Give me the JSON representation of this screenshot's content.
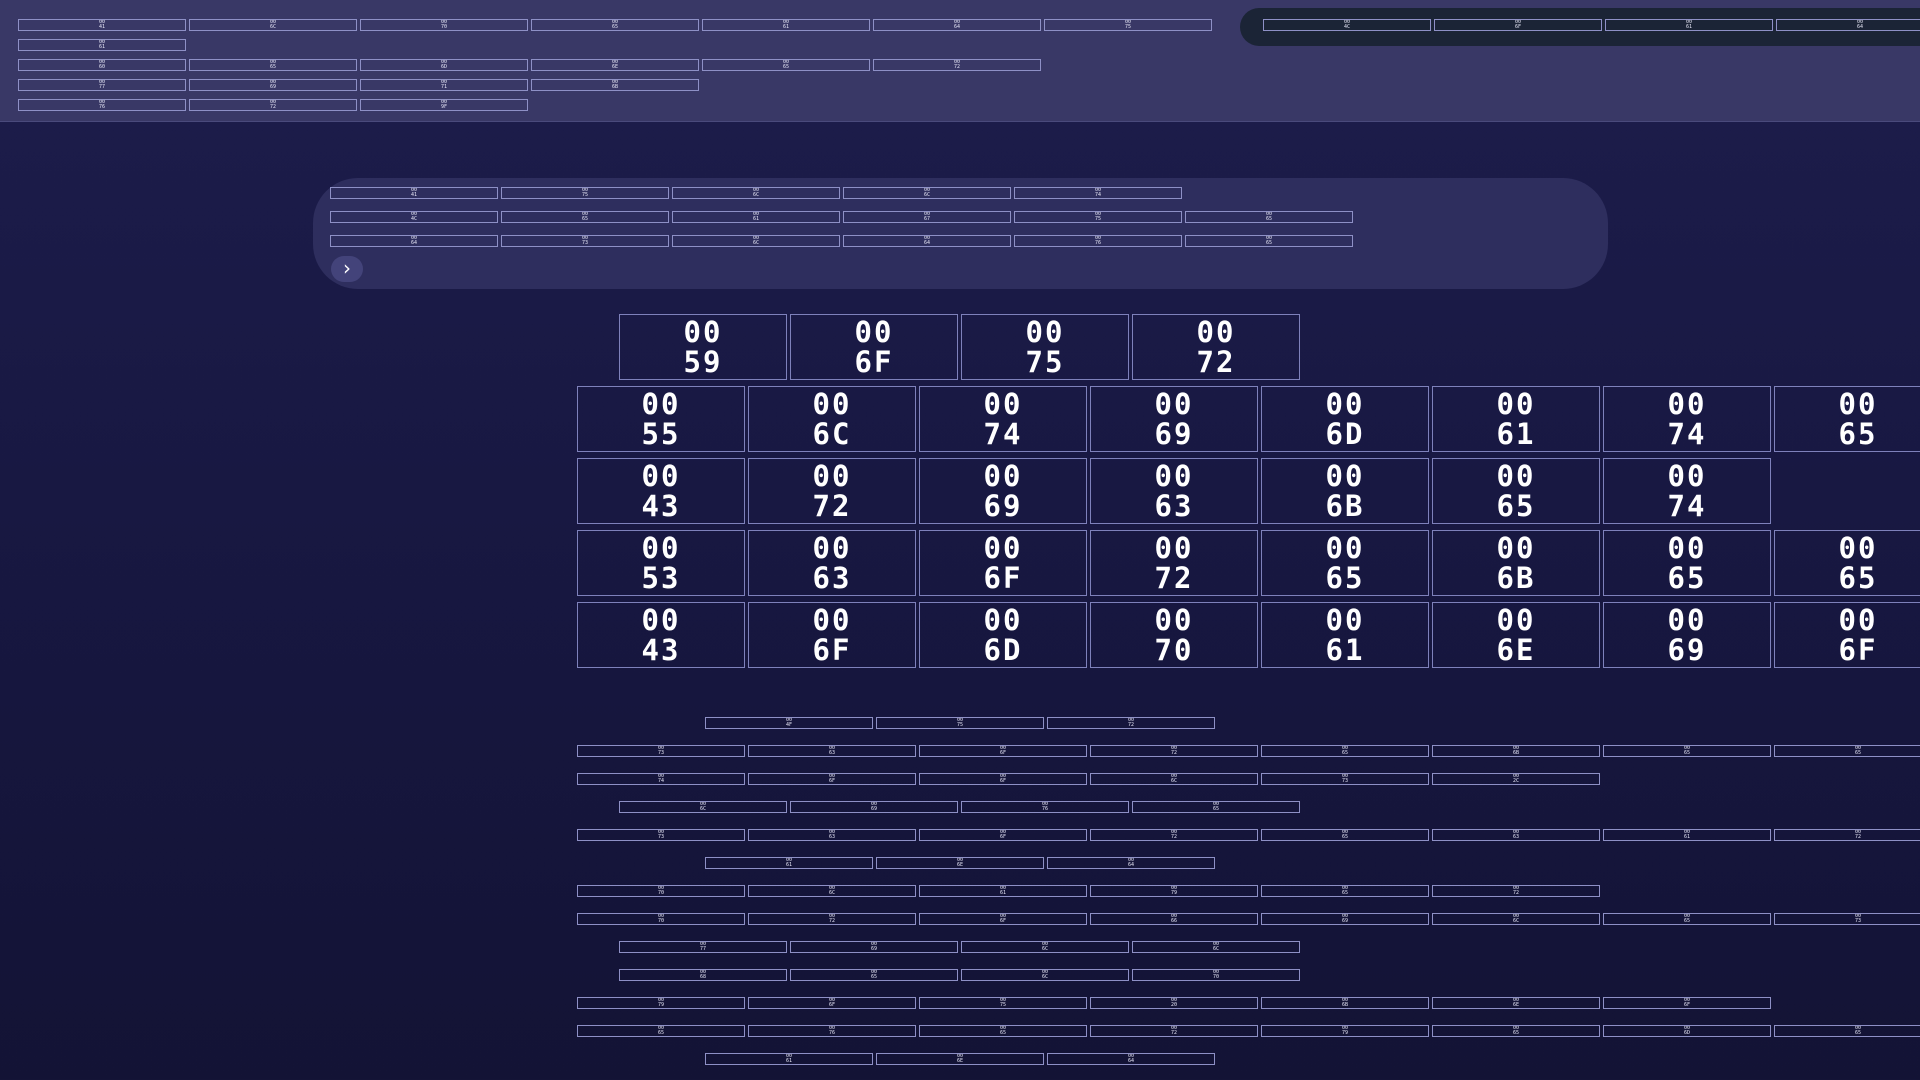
{
  "nav_icon": "chevron-right-icon",
  "nav_glyph": "›",
  "hex_prefix": "00",
  "top_block": [
    [
      "41",
      "6C",
      "70",
      "65",
      "61",
      "64",
      "75"
    ],
    [
      "61"
    ],
    [
      "60",
      "65",
      "6D",
      "6E",
      "65",
      "72"
    ],
    [
      "77",
      "69",
      "71",
      "6B"
    ],
    [
      "76",
      "72",
      "9F"
    ]
  ],
  "top_right_block": [
    [
      "4C",
      "6F",
      "61",
      "64"
    ]
  ],
  "panel_block": [
    [
      "41",
      "75",
      "6C",
      "6C",
      "74"
    ],
    [
      "4C",
      "65",
      "61",
      "67",
      "75",
      "65"
    ],
    [
      "64",
      "73",
      "6C",
      "64",
      "76",
      "65"
    ]
  ],
  "large_block": [
    [
      "59",
      "6F",
      "75",
      "72"
    ],
    [
      "55",
      "6C",
      "74",
      "69",
      "6D",
      "61",
      "74",
      "65"
    ],
    [
      "43",
      "72",
      "69",
      "63",
      "6B",
      "65",
      "74"
    ],
    [
      "53",
      "63",
      "6F",
      "72",
      "65",
      "6B",
      "65",
      "65"
    ],
    [
      "43",
      "6F",
      "6D",
      "70",
      "61",
      "6E",
      "69",
      "6F"
    ]
  ],
  "bottom_block": [
    [
      "4F",
      "75",
      "72"
    ],
    [
      "73",
      "63",
      "6F",
      "72",
      "65",
      "6B",
      "65",
      "65"
    ],
    [
      "74",
      "6F",
      "6F",
      "6C",
      "73",
      "2C"
    ],
    [
      "6C",
      "69",
      "76",
      "65"
    ],
    [
      "73",
      "63",
      "6F",
      "72",
      "65",
      "63",
      "61",
      "72"
    ],
    [
      "61",
      "6E",
      "64"
    ],
    [
      "70",
      "6C",
      "61",
      "79",
      "65",
      "72"
    ],
    [
      "70",
      "72",
      "6F",
      "66",
      "69",
      "6C",
      "65",
      "73"
    ],
    [
      "77",
      "69",
      "6C",
      "6C"
    ],
    [
      "68",
      "65",
      "6C",
      "70"
    ],
    [
      "79",
      "6F",
      "75",
      "20",
      "6B",
      "6E",
      "6F"
    ],
    [
      "65",
      "76",
      "65",
      "72",
      "79",
      "65",
      "6D",
      "65"
    ],
    [
      "61",
      "6E",
      "64"
    ]
  ]
}
